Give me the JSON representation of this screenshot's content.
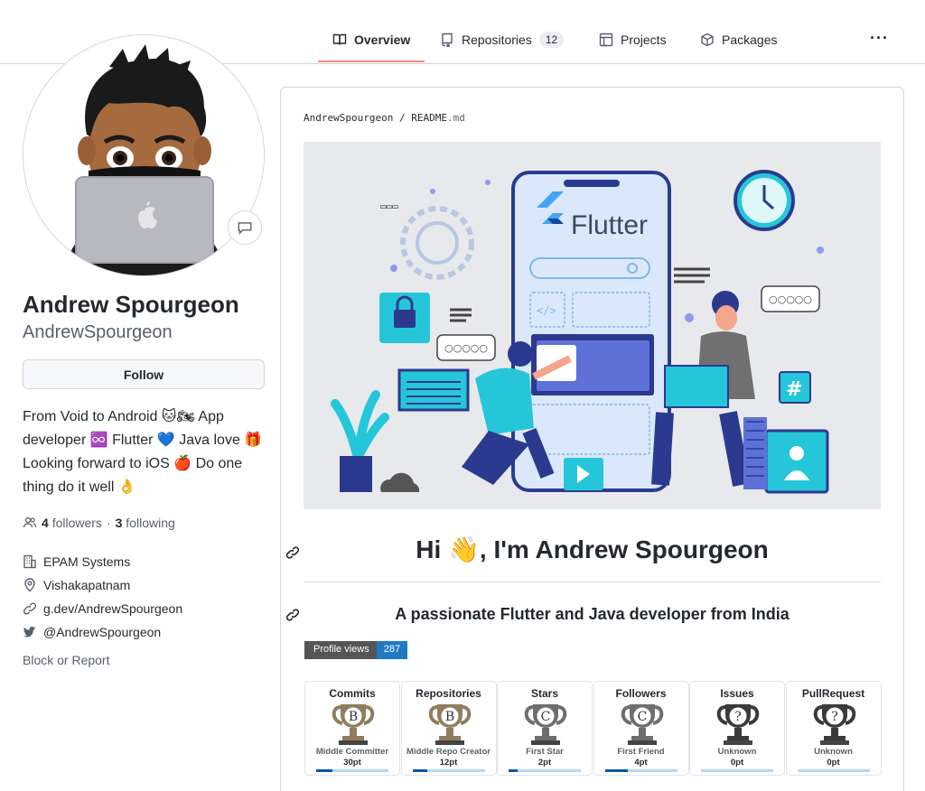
{
  "nav": {
    "tabs": [
      {
        "label": "Overview",
        "icon": "book-icon",
        "selected": true
      },
      {
        "label": "Repositories",
        "icon": "repo-icon",
        "count": "12"
      },
      {
        "label": "Projects",
        "icon": "table-icon"
      },
      {
        "label": "Packages",
        "icon": "package-icon"
      }
    ],
    "more_label": "···",
    "accent": "#fd8c73"
  },
  "profile": {
    "name": "Andrew Spourgeon",
    "username": "AndrewSpourgeon",
    "follow_label": "Follow",
    "bio": "From Void to Android 🐱🏍 App developer ♾️ Flutter 💙 Java love 🎁 Looking forward to iOS 🍎 Do one thing do it well 👌",
    "followers_count": "4",
    "followers_label": "followers",
    "separator": "·",
    "following_count": "3",
    "following_label": "following",
    "company": "EPAM Systems",
    "location": "Vishakapatnam",
    "website": "g.dev/AndrewSpourgeon",
    "twitter": "@AndrewSpourgeon",
    "block_label": "Block or Report"
  },
  "readme": {
    "path_user": "AndrewSpourgeon",
    "path_sep": " / ",
    "path_file": "README",
    "path_ext": ".md",
    "banner_text": "Flutter",
    "heading": "Hi 👋, I'm Andrew Spourgeon",
    "subheading": "A passionate Flutter and Java developer from India",
    "views_label": "Profile views",
    "views_count": "287",
    "trophies": [
      {
        "title": "Commits",
        "letter": "B",
        "rank": "Middle Committer",
        "points": "30pt",
        "color": "#8f7d5e",
        "progress": 0.22
      },
      {
        "title": "Repositories",
        "letter": "B",
        "rank": "Middle Repo Creator",
        "points": "12pt",
        "color": "#8f7d5e",
        "progress": 0.2
      },
      {
        "title": "Stars",
        "letter": "C",
        "rank": "First Star",
        "points": "2pt",
        "color": "#6e6e6e",
        "progress": 0.12
      },
      {
        "title": "Followers",
        "letter": "C",
        "rank": "First Friend",
        "points": "4pt",
        "color": "#6e6e6e",
        "progress": 0.32
      },
      {
        "title": "Issues",
        "letter": "?",
        "rank": "Unknown",
        "points": "0pt",
        "color": "#3a3a3a",
        "progress": 0
      },
      {
        "title": "PullRequest",
        "letter": "?",
        "rank": "Unknown",
        "points": "0pt",
        "color": "#3a3a3a",
        "progress": 0
      }
    ]
  }
}
